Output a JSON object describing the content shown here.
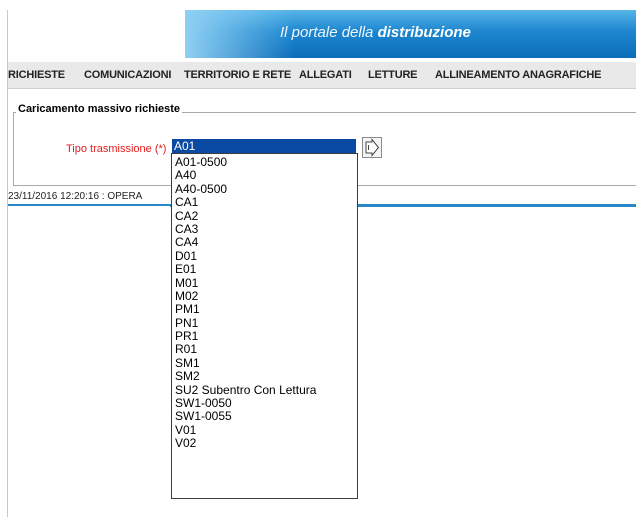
{
  "banner": {
    "title_prefix": "Il portale della ",
    "title_bold": "distribuzione"
  },
  "menu": {
    "items": [
      "RICHIESTE",
      "COMUNICAZIONI",
      "TERRITORIO E RETE",
      "ALLEGATI",
      "LETTURE",
      "ALLINEAMENTO ANAGRAFICHE"
    ]
  },
  "form": {
    "legend": "Caricamento massivo richieste",
    "field_label": "Tipo trasmissione (*)",
    "selected": "A01",
    "options": [
      "A01-0500",
      "A40",
      "A40-0500",
      "CA1",
      "CA2",
      "CA3",
      "CA4",
      "D01",
      "E01",
      "M01",
      "M02",
      "PM1",
      "PN1",
      "PR1",
      "R01",
      "SM1",
      "SM2",
      "SU2 Subentro Con Lettura",
      "SW1-0050",
      "SW1-0055",
      "V01",
      "V02"
    ]
  },
  "status": {
    "text": "23/11/2016 12:20:16  :  OPERA"
  }
}
